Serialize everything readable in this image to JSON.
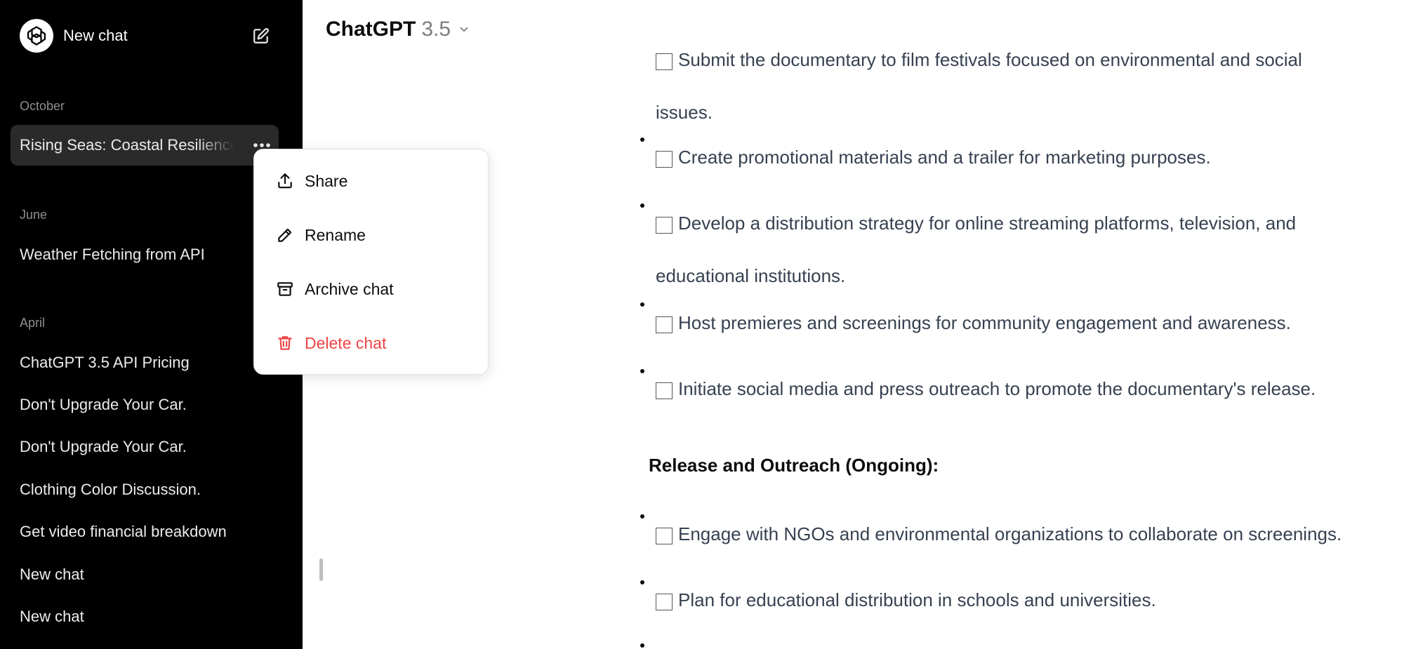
{
  "sidebar": {
    "new_chat_label": "New chat",
    "sections": [
      {
        "label": "October",
        "items": [
          "Rising Seas: Coastal Resilience"
        ]
      },
      {
        "label": "June",
        "items": [
          "Weather Fetching from API"
        ]
      },
      {
        "label": "April",
        "items": [
          "ChatGPT 3.5 API Pricing",
          "Don't Upgrade Your Car.",
          "Don't Upgrade Your Car.",
          "Clothing Color Discussion.",
          "Get video financial breakdown",
          "New chat",
          "New chat"
        ]
      }
    ]
  },
  "header": {
    "model_name": "ChatGPT",
    "model_version": "3.5"
  },
  "context_menu": {
    "items": [
      {
        "label": "Share",
        "icon": "share-icon"
      },
      {
        "label": "Rename",
        "icon": "pencil-icon"
      },
      {
        "label": "Archive chat",
        "icon": "archive-icon"
      },
      {
        "label": "Delete chat",
        "icon": "trash-icon",
        "color": "#ef4444"
      }
    ]
  },
  "content": {
    "lines": [
      "Submit the documentary to film festivals focused on environmental and social",
      "issues.",
      "Create promotional materials and a trailer for marketing purposes.",
      "Develop a distribution strategy for online streaming platforms, television, and",
      "educational institutions.",
      "Host premieres and screenings for community engagement and awareness.",
      "Initiate social media and press outreach to promote the documentary's release.",
      "Release and Outreach (Ongoing):",
      "Engage with NGOs and environmental organizations to collaborate on screenings.",
      "Plan for educational distribution in schools and universities."
    ]
  },
  "colors": {
    "sidebar_bg": "#000000",
    "active_item_bg": "#2a2a2a",
    "danger": "#ef4444",
    "text": "#374151"
  }
}
